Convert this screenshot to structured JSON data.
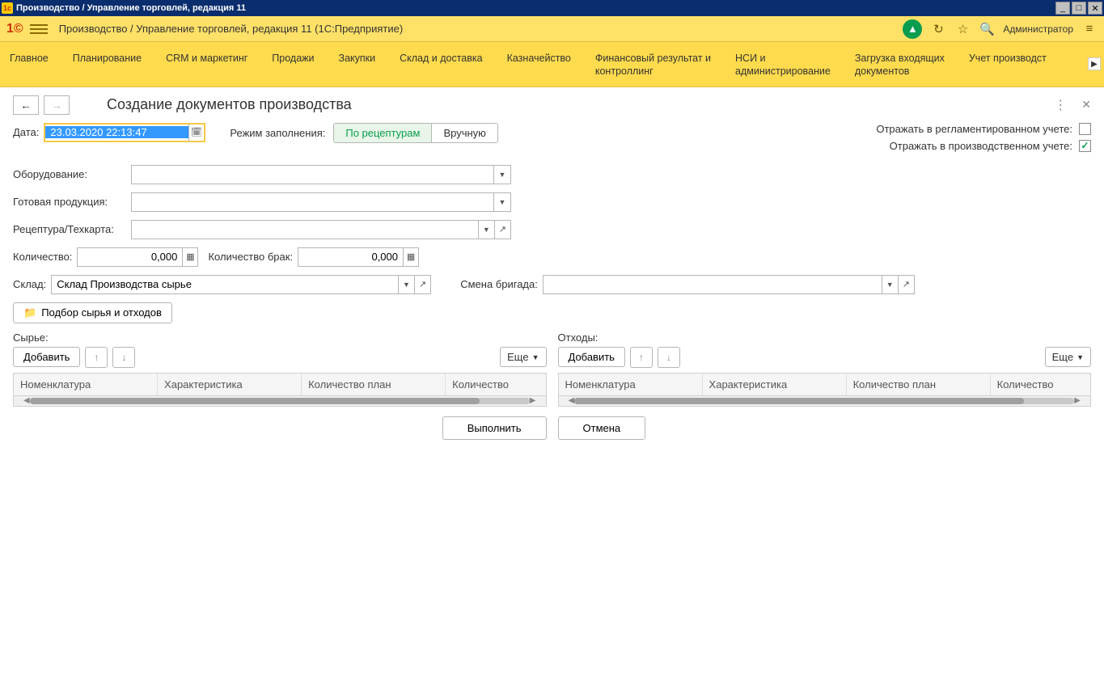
{
  "window": {
    "title": "Производство / Управление торговлей, редакция 11"
  },
  "header": {
    "app_title": "Производство / Управление торговлей, редакция 11  (1С:Предприятие)",
    "user": "Администратор"
  },
  "nav": {
    "items": [
      "Главное",
      "Планирование",
      "CRM и маркетинг",
      "Продажи",
      "Закупки",
      "Склад и доставка",
      "Казначейство",
      "Финансовый результат и\nконтроллинг",
      "НСИ и\nадминистрирование",
      "Загрузка входящих\nдокументов",
      "Учет производст"
    ]
  },
  "form": {
    "title": "Создание документов производства",
    "labels": {
      "date": "Дата:",
      "fill_mode": "Режим заполнения:",
      "equipment": "Оборудование:",
      "product": "Готовая продукция:",
      "recipe": "Рецептура/Техкарта:",
      "qty": "Количество:",
      "qty_defect": "Количество брак:",
      "warehouse": "Склад:",
      "shift": "Смена бригада:",
      "reg_accounting": "Отражать в регламентированном учете:",
      "prod_accounting": "Отражать в производственном учете:"
    },
    "values": {
      "date": "23.03.2020 22:13:47",
      "qty": "0,000",
      "qty_defect": "0,000",
      "warehouse": "Склад Производства сырье"
    },
    "toggles": {
      "by_recipe": "По рецептурам",
      "manual": "Вручную"
    },
    "checks": {
      "reg": false,
      "prod": true
    },
    "pick_btn": "Подбор сырья и отходов",
    "raw": {
      "title": "Сырье:",
      "add": "Добавить",
      "more": "Еще",
      "columns": [
        "Номенклатура",
        "Характеристика",
        "Количество план",
        "Количество"
      ]
    },
    "waste": {
      "title": "Отходы:",
      "add": "Добавить",
      "more": "Еще",
      "columns": [
        "Номенклатура",
        "Характеристика",
        "Количество план",
        "Количество"
      ]
    },
    "footer": {
      "execute": "Выполнить",
      "cancel": "Отмена"
    }
  }
}
